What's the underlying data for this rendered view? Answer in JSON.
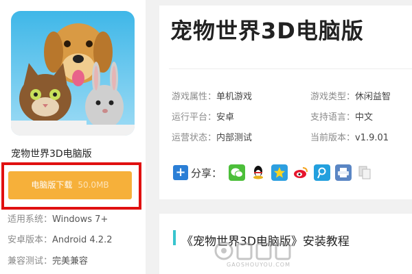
{
  "app": {
    "name": "宠物世界3D电脑版",
    "title": "宠物世界3D电脑版"
  },
  "download": {
    "label": "电脑版下载",
    "size": "50.0MB"
  },
  "meta": [
    {
      "key": "适用系统：",
      "value": "Windows 7+"
    },
    {
      "key": "安卓版本：",
      "value": "Android 4.2.2"
    },
    {
      "key": "兼容测试：",
      "value": "完美兼容"
    }
  ],
  "info": [
    {
      "key": "游戏属性：",
      "value": "单机游戏"
    },
    {
      "key": "游戏类型：",
      "value": "休闲益智"
    },
    {
      "key": "运行平台：",
      "value": "安卓"
    },
    {
      "key": "支持语言：",
      "value": "中文"
    },
    {
      "key": "运营状态：",
      "value": "内部测试"
    },
    {
      "key": "当前版本：",
      "value": "v1.9.01"
    }
  ],
  "share": {
    "label": "分享：",
    "icons": [
      "wechat-icon",
      "qq-icon",
      "qzone-icon",
      "weibo-icon",
      "tencent-weibo-icon",
      "print-icon",
      "copy-icon"
    ]
  },
  "tutorial": {
    "title": "《宠物世界3D电脑版》安装教程"
  },
  "watermark": {
    "url": "GAOSHOUYOU.COM"
  },
  "colors": {
    "download_button": "#f6b03a",
    "highlight_frame": "#e01010",
    "share_plus": "#2b7fd6",
    "tutorial_bar": "#38c4ce"
  }
}
